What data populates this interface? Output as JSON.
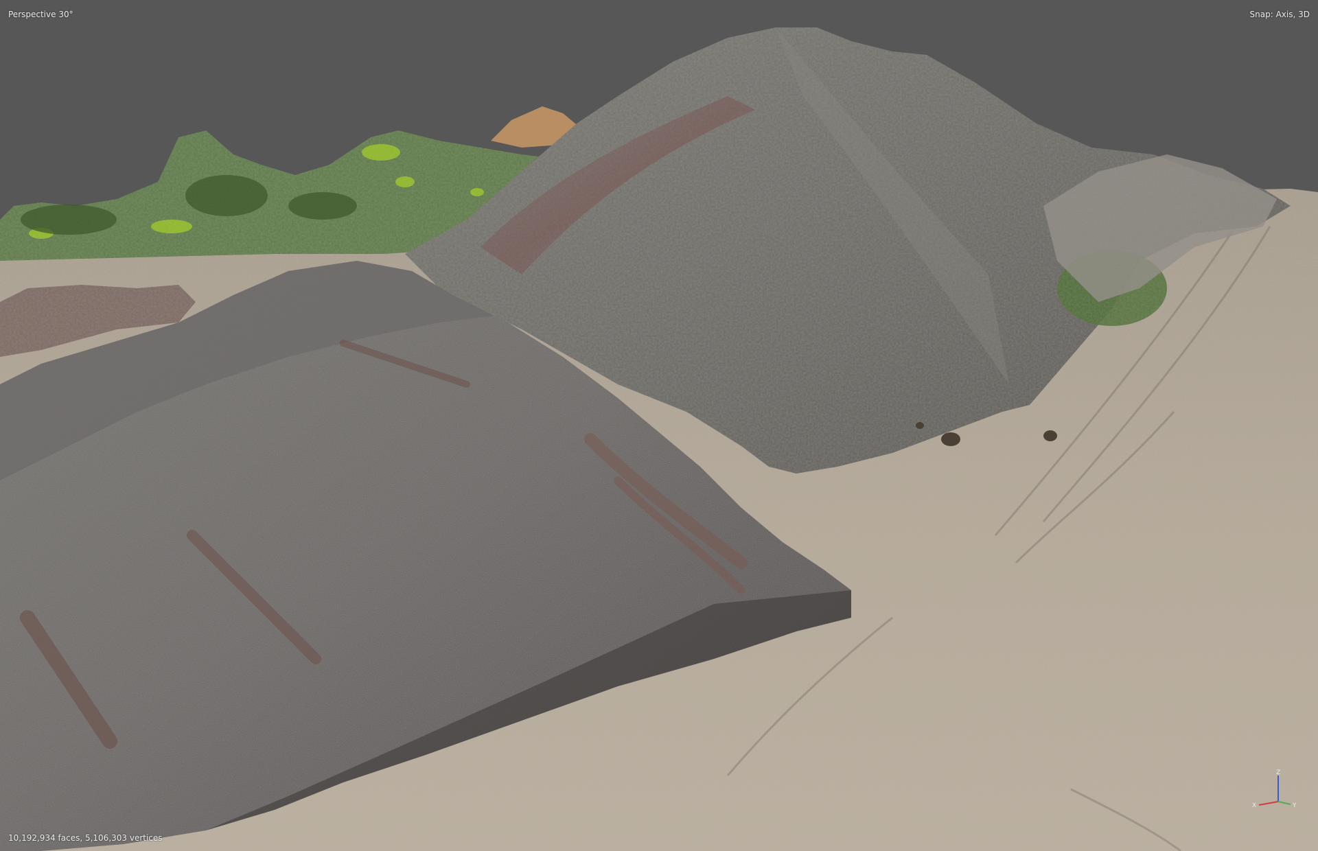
{
  "viewport": {
    "view_mode": "Perspective 30°",
    "snap_status": "Snap: Axis, 3D",
    "mesh_stats": "10,192,934 faces, 5,106,303 vertices",
    "background_color": "#575757"
  },
  "axis_gizmo": {
    "x_label": "X",
    "y_label": "Y",
    "z_label": "Z",
    "x_color": "#d23c3c",
    "y_color": "#5aaa50",
    "z_color": "#3a5ad8"
  },
  "scene": {
    "description_icon": "3d-mesh-terrain",
    "ground_color": "#b9ad9c",
    "pile_color": "#6b6866",
    "vegetation_color": "#5c8a3c"
  }
}
